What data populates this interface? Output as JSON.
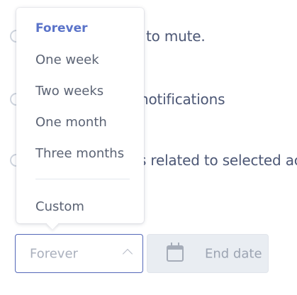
{
  "options": [
    {
      "label": "to mute."
    },
    {
      "label": "notifications"
    },
    {
      "label": "s related to selected acc"
    }
  ],
  "duration_menu": {
    "items": [
      {
        "label": "Forever",
        "selected": true
      },
      {
        "label": "One week"
      },
      {
        "label": "Two weeks"
      },
      {
        "label": "One month"
      },
      {
        "label": "Three months"
      },
      {
        "label": "Custom"
      }
    ]
  },
  "duration_select": {
    "value": "Forever"
  },
  "end_date": {
    "placeholder": "End date"
  },
  "colors": {
    "accent": "#5a73c9",
    "text": "#4c5775"
  }
}
